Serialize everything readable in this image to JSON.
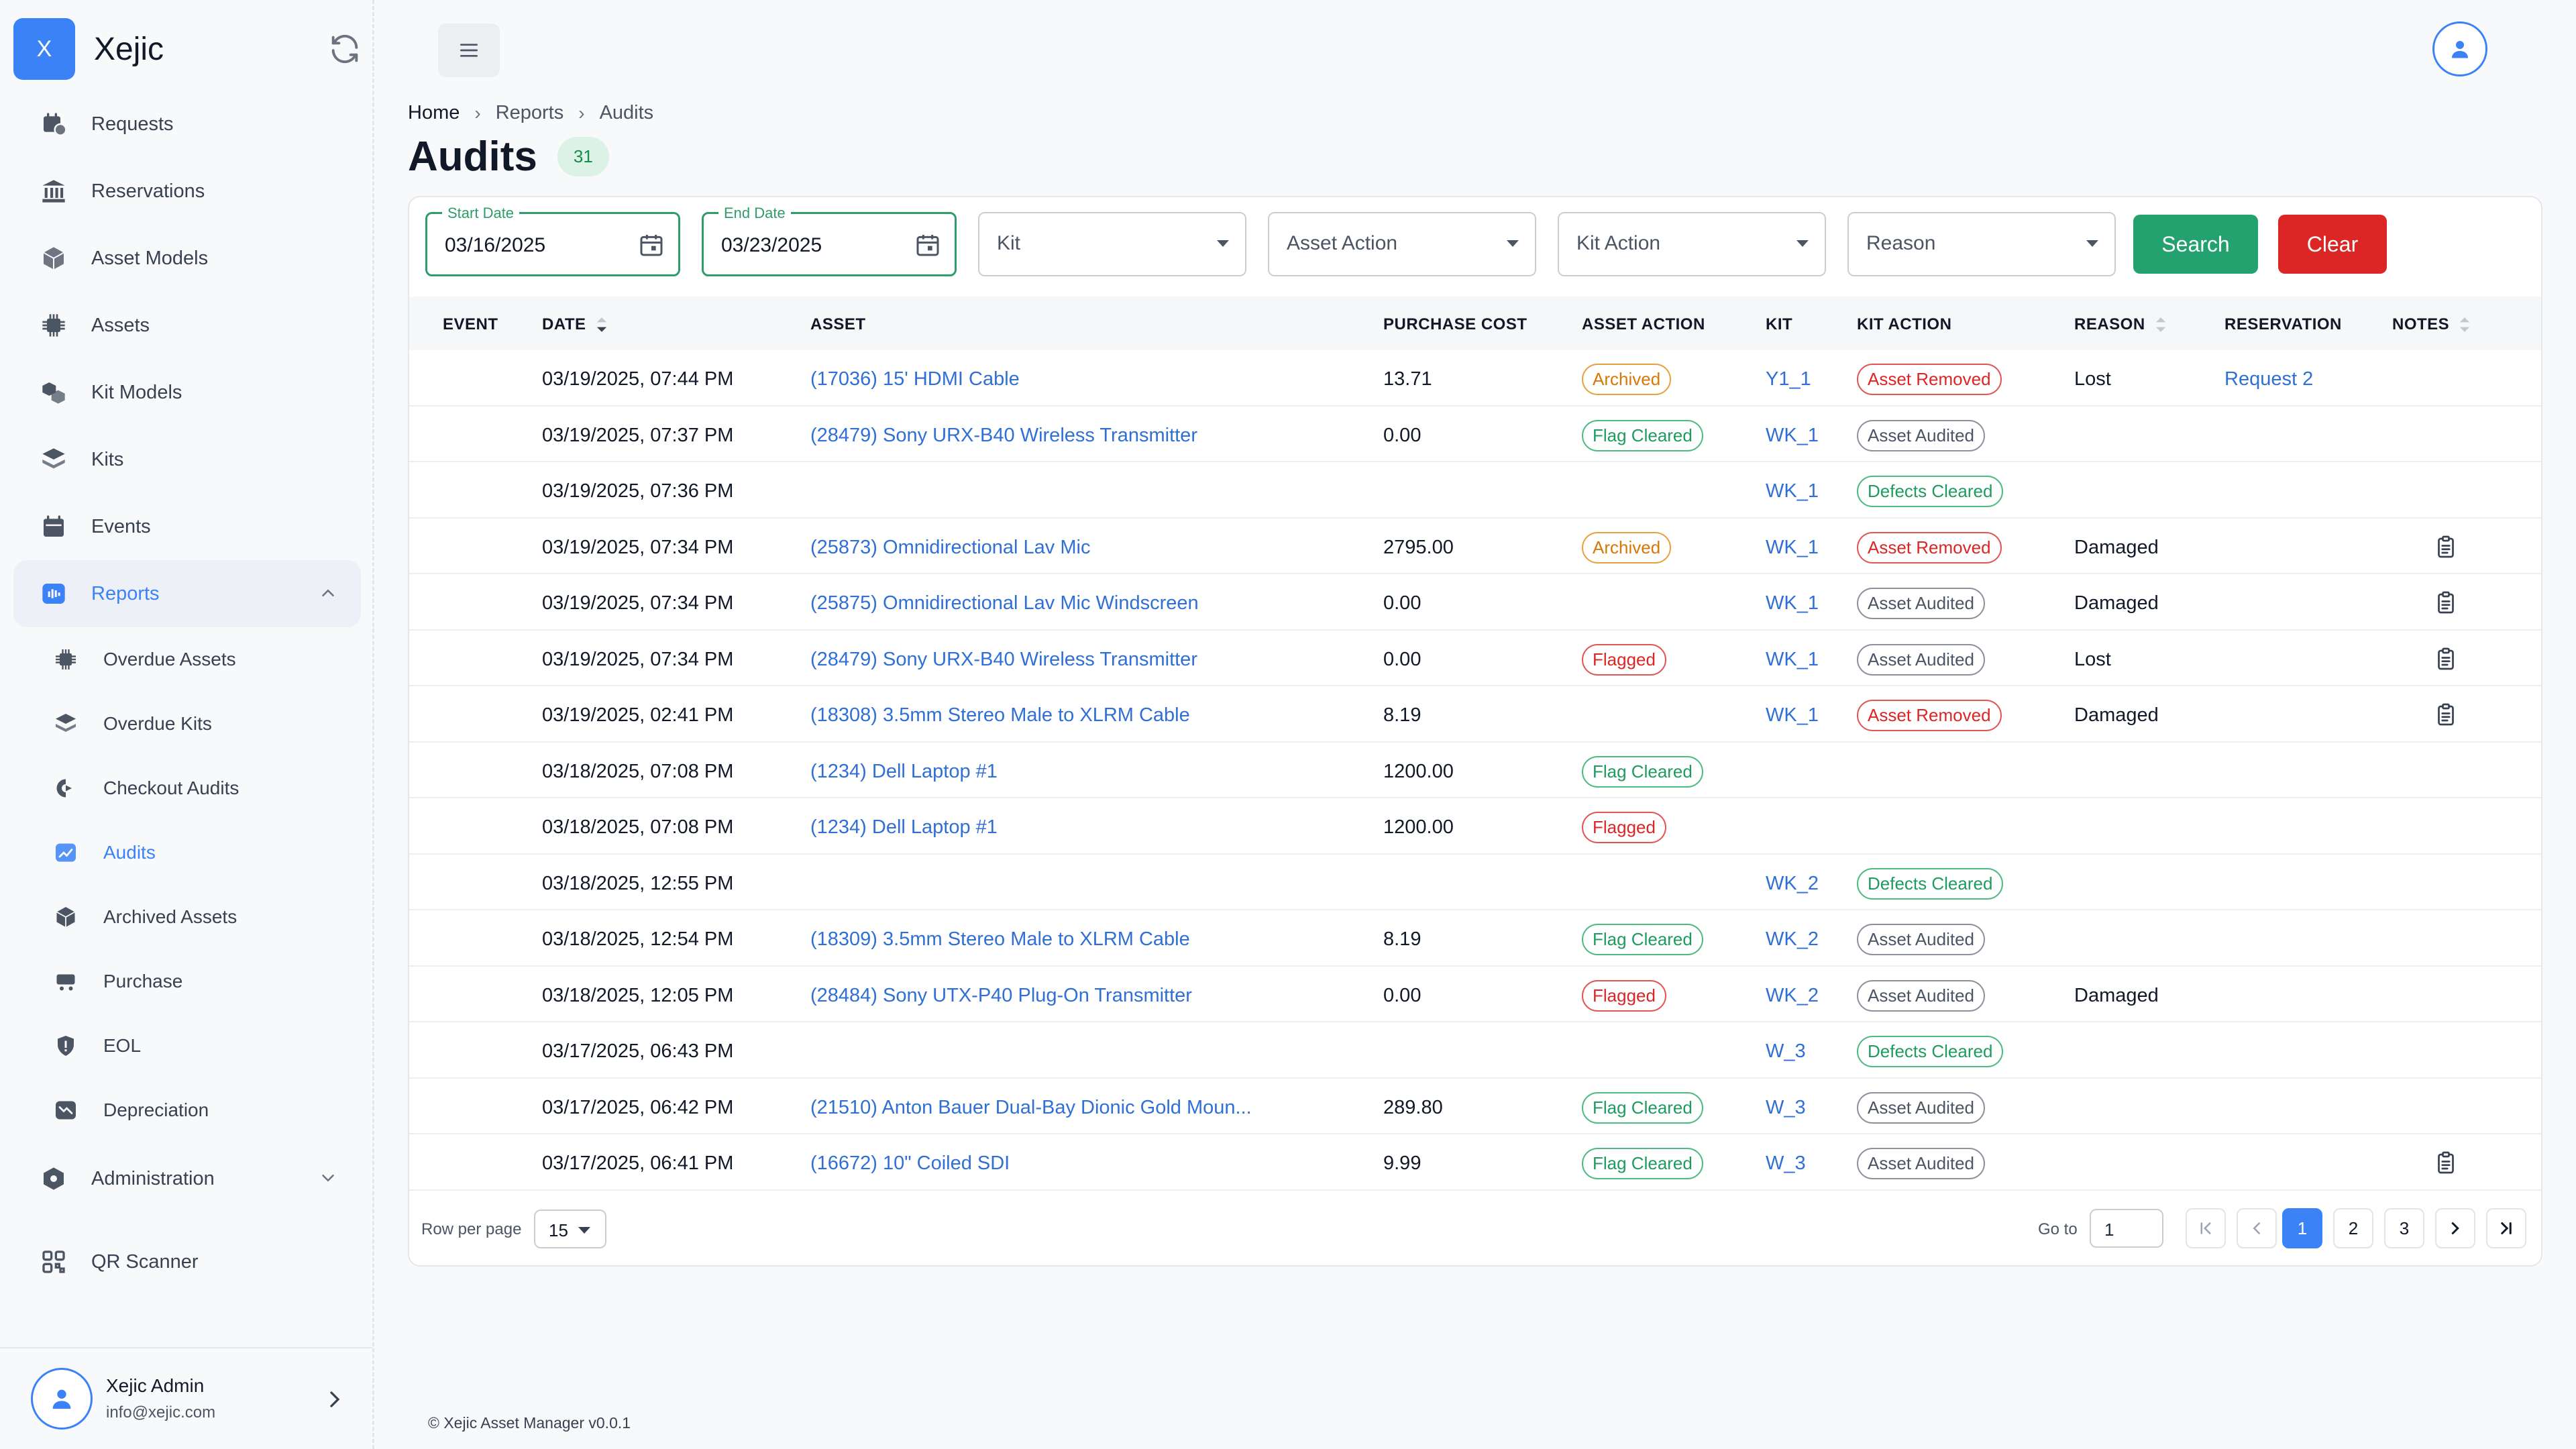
{
  "app": {
    "logo_letter": "X",
    "name": "Xejic"
  },
  "sidebar": {
    "items": [
      {
        "label": "Requests",
        "icon": "calendar-clock-icon"
      },
      {
        "label": "Reservations",
        "icon": "bank-icon"
      },
      {
        "label": "Asset Models",
        "icon": "cube-icon"
      },
      {
        "label": "Assets",
        "icon": "chip-icon"
      },
      {
        "label": "Kit Models",
        "icon": "cubes-icon"
      },
      {
        "label": "Kits",
        "icon": "layers-icon"
      },
      {
        "label": "Events",
        "icon": "calendar-icon"
      },
      {
        "label": "Reports",
        "icon": "chart-icon"
      }
    ],
    "reports_sub": [
      {
        "label": "Overdue Assets",
        "icon": "chip-icon"
      },
      {
        "label": "Overdue Kits",
        "icon": "layers-icon"
      },
      {
        "label": "Checkout Audits",
        "icon": "checkout-icon"
      },
      {
        "label": "Audits",
        "icon": "trend-icon"
      },
      {
        "label": "Archived Assets",
        "icon": "archive-box-icon"
      },
      {
        "label": "Purchase",
        "icon": "cart-icon"
      },
      {
        "label": "EOL",
        "icon": "alert-shield-icon"
      },
      {
        "label": "Depreciation",
        "icon": "depreciation-icon"
      }
    ],
    "administration": "Administration",
    "qr_scanner": "QR Scanner",
    "user": {
      "name": "Xejic Admin",
      "email": "info@xejic.com"
    }
  },
  "breadcrumb": {
    "home": "Home",
    "reports": "Reports",
    "current": "Audits"
  },
  "page": {
    "title": "Audits",
    "count": "31"
  },
  "filters": {
    "start_date_label": "Start Date",
    "start_date": "03/16/2025",
    "end_date_label": "End Date",
    "end_date": "03/23/2025",
    "kit": "Kit",
    "asset_action": "Asset Action",
    "kit_action": "Kit Action",
    "reason": "Reason",
    "search": "Search",
    "clear": "Clear"
  },
  "columns": {
    "event": "EVENT",
    "date": "DATE",
    "asset": "ASSET",
    "purchase_cost": "PURCHASE COST",
    "asset_action": "ASSET ACTION",
    "kit": "KIT",
    "kit_action": "KIT ACTION",
    "reason": "REASON",
    "reservation": "RESERVATION",
    "notes": "NOTES"
  },
  "colors": {
    "accent": "#3b82f6",
    "search": "#23a26d",
    "clear": "#dc2626",
    "archived": "#d97706",
    "flagged": "#dc2626",
    "cleared": "#1e9b5e"
  },
  "rows": [
    {
      "date": "03/19/2025, 07:44 PM",
      "asset": "(17036) 15' HDMI Cable",
      "cost": "13.71",
      "asset_action": "Archived",
      "kit": "Y1_1",
      "kit_action": "Asset Removed",
      "reason": "Lost",
      "reservation": "Request 2",
      "note": false
    },
    {
      "date": "03/19/2025, 07:37 PM",
      "asset": "(28479) Sony URX-B40 Wireless Transmitter",
      "cost": "0.00",
      "asset_action": "Flag Cleared",
      "kit": "WK_1",
      "kit_action": "Asset Audited",
      "reason": "",
      "reservation": "",
      "note": false
    },
    {
      "date": "03/19/2025, 07:36 PM",
      "asset": "",
      "cost": "",
      "asset_action": "",
      "kit": "WK_1",
      "kit_action": "Defects Cleared",
      "reason": "",
      "reservation": "",
      "note": false
    },
    {
      "date": "03/19/2025, 07:34 PM",
      "asset": "(25873) Omnidirectional Lav Mic",
      "cost": "2795.00",
      "asset_action": "Archived",
      "kit": "WK_1",
      "kit_action": "Asset Removed",
      "reason": "Damaged",
      "reservation": "",
      "note": true
    },
    {
      "date": "03/19/2025, 07:34 PM",
      "asset": "(25875) Omnidirectional Lav Mic Windscreen",
      "cost": "0.00",
      "asset_action": "",
      "kit": "WK_1",
      "kit_action": "Asset Audited",
      "reason": "Damaged",
      "reservation": "",
      "note": true
    },
    {
      "date": "03/19/2025, 07:34 PM",
      "asset": "(28479) Sony URX-B40 Wireless Transmitter",
      "cost": "0.00",
      "asset_action": "Flagged",
      "kit": "WK_1",
      "kit_action": "Asset Audited",
      "reason": "Lost",
      "reservation": "",
      "note": true
    },
    {
      "date": "03/19/2025, 02:41 PM",
      "asset": "(18308) 3.5mm Stereo Male to XLRM Cable",
      "cost": "8.19",
      "asset_action": "",
      "kit": "WK_1",
      "kit_action": "Asset Removed",
      "reason": "Damaged",
      "reservation": "",
      "note": true
    },
    {
      "date": "03/18/2025, 07:08 PM",
      "asset": "(1234) Dell Laptop #1",
      "cost": "1200.00",
      "asset_action": "Flag Cleared",
      "kit": "",
      "kit_action": "",
      "reason": "",
      "reservation": "",
      "note": false
    },
    {
      "date": "03/18/2025, 07:08 PM",
      "asset": "(1234) Dell Laptop #1",
      "cost": "1200.00",
      "asset_action": "Flagged",
      "kit": "",
      "kit_action": "",
      "reason": "",
      "reservation": "",
      "note": false
    },
    {
      "date": "03/18/2025, 12:55 PM",
      "asset": "",
      "cost": "",
      "asset_action": "",
      "kit": "WK_2",
      "kit_action": "Defects Cleared",
      "reason": "",
      "reservation": "",
      "note": false
    },
    {
      "date": "03/18/2025, 12:54 PM",
      "asset": "(18309) 3.5mm Stereo Male to XLRM Cable",
      "cost": "8.19",
      "asset_action": "Flag Cleared",
      "kit": "WK_2",
      "kit_action": "Asset Audited",
      "reason": "",
      "reservation": "",
      "note": false
    },
    {
      "date": "03/18/2025, 12:05 PM",
      "asset": "(28484) Sony UTX-P40 Plug-On Transmitter",
      "cost": "0.00",
      "asset_action": "Flagged",
      "kit": "WK_2",
      "kit_action": "Asset Audited",
      "reason": "Damaged",
      "reservation": "",
      "note": false
    },
    {
      "date": "03/17/2025, 06:43 PM",
      "asset": "",
      "cost": "",
      "asset_action": "",
      "kit": "W_3",
      "kit_action": "Defects Cleared",
      "reason": "",
      "reservation": "",
      "note": false
    },
    {
      "date": "03/17/2025, 06:42 PM",
      "asset": "(21510) Anton Bauer Dual-Bay Dionic Gold Moun...",
      "cost": "289.80",
      "asset_action": "Flag Cleared",
      "kit": "W_3",
      "kit_action": "Asset Audited",
      "reason": "",
      "reservation": "",
      "note": false
    },
    {
      "date": "03/17/2025, 06:41 PM",
      "asset": "(16672) 10\" Coiled SDI",
      "cost": "9.99",
      "asset_action": "Flag Cleared",
      "kit": "W_3",
      "kit_action": "Asset Audited",
      "reason": "",
      "reservation": "",
      "note": true
    }
  ],
  "pagination": {
    "rows_per_page_label": "Row per page",
    "rows_per_page": "15",
    "goto_label": "Go to",
    "goto_value": "1",
    "pages": [
      "1",
      "2",
      "3"
    ],
    "current": "1"
  },
  "footer": {
    "copyright": "© Xejic Asset Manager v0.0.1"
  }
}
